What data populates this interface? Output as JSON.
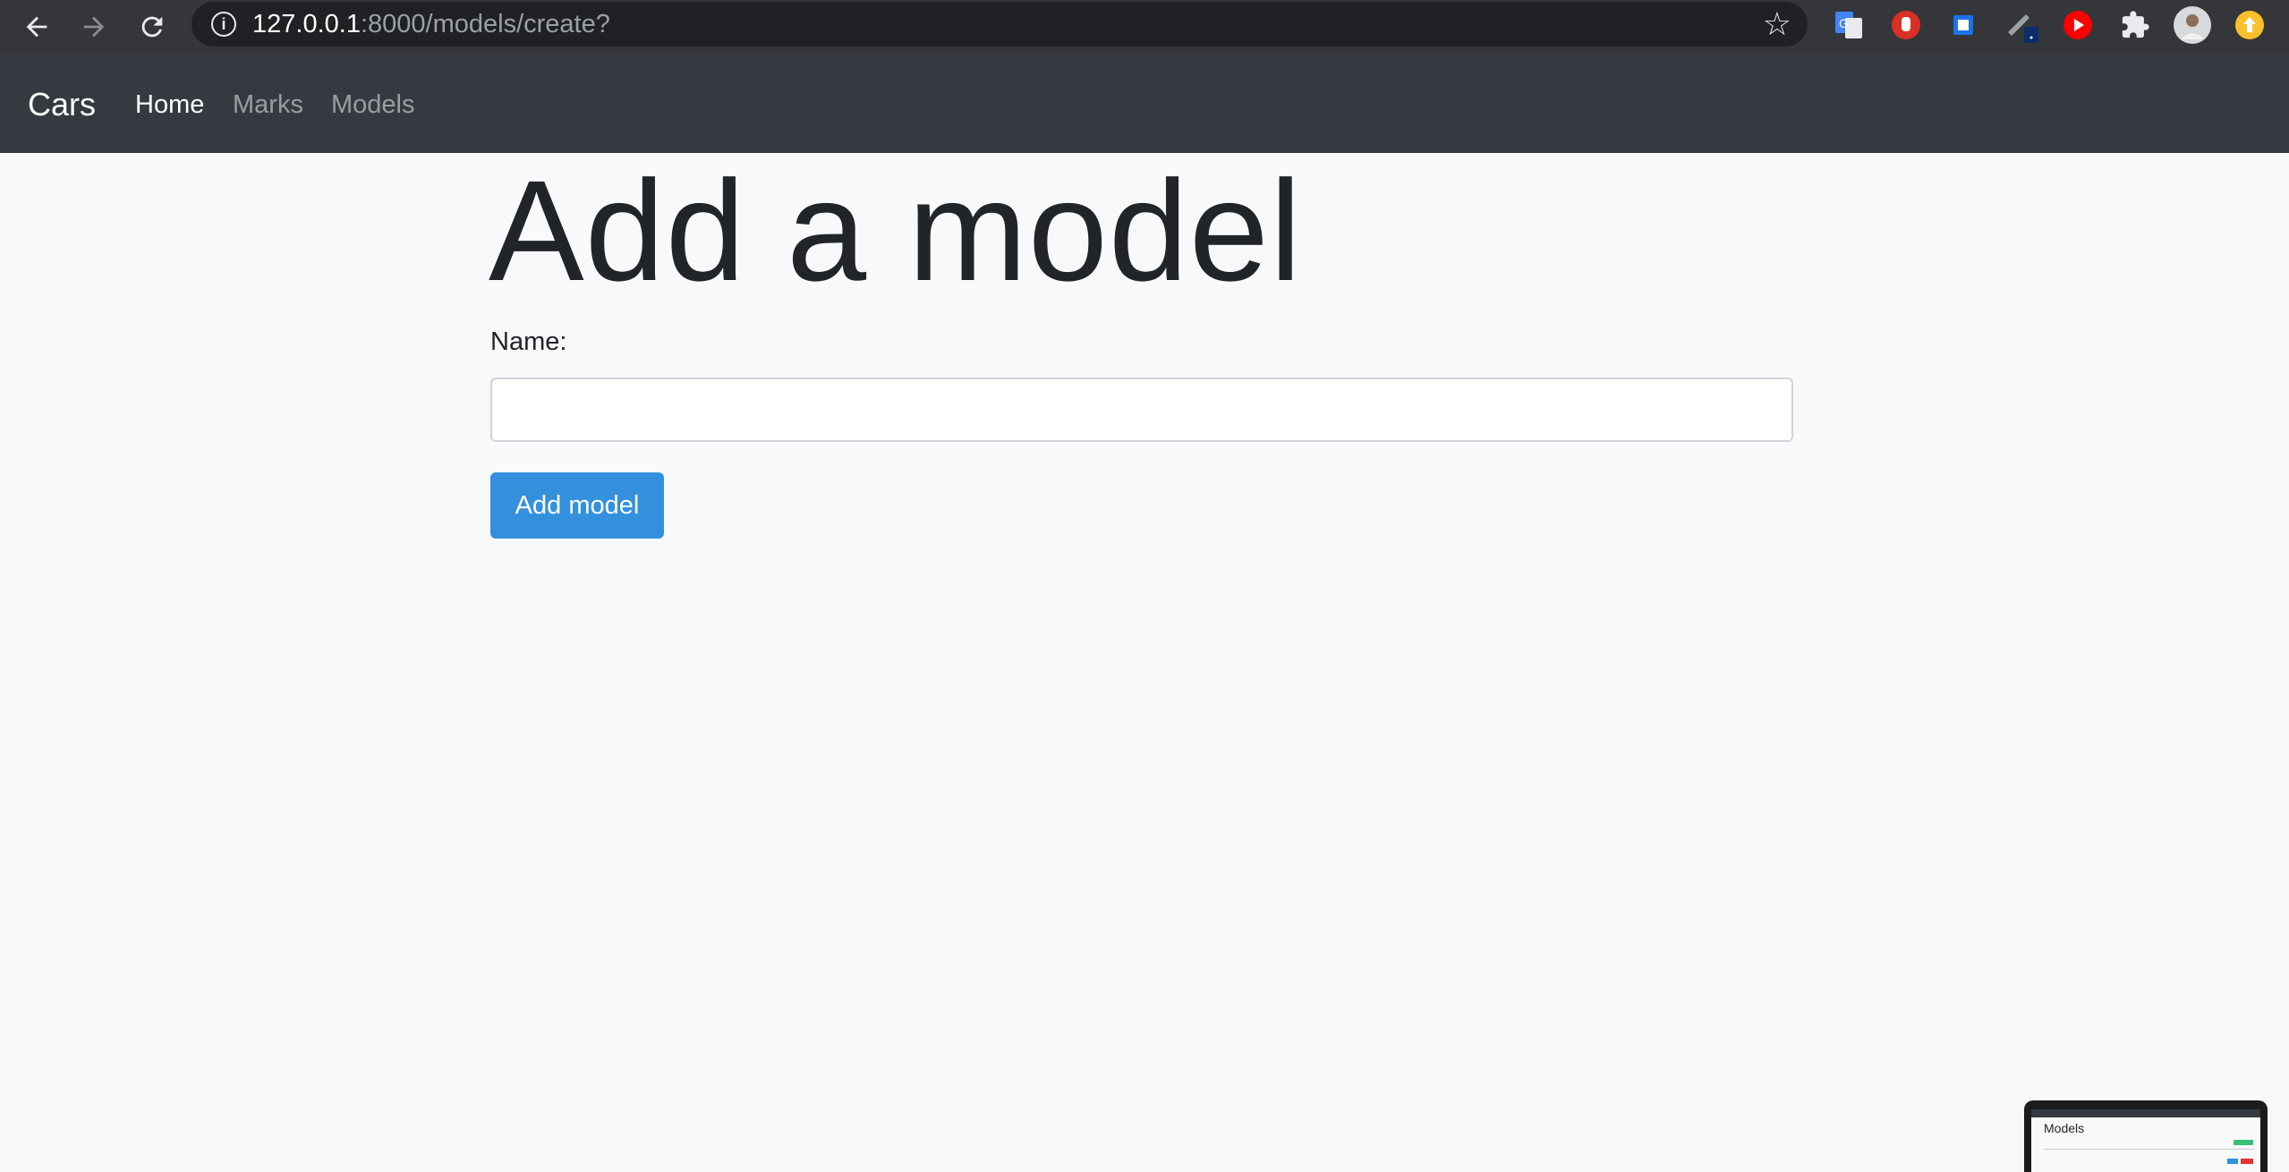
{
  "browser": {
    "url_host": "127.0.0.1",
    "url_rest": ":8000/models/create?"
  },
  "navbar": {
    "brand": "Cars",
    "links": [
      {
        "label": "Home",
        "active": true
      },
      {
        "label": "Marks",
        "active": false
      },
      {
        "label": "Models",
        "active": false
      }
    ]
  },
  "main": {
    "title": "Add a model",
    "name_label": "Name:",
    "name_value": "",
    "name_placeholder": "",
    "submit_label": "Add model"
  },
  "thumbnail": {
    "title": "Models"
  },
  "colors": {
    "navbar_bg": "#343a40",
    "primary": "#3490dc",
    "page_bg": "#f8f9fa"
  },
  "icons": {
    "back": "arrow-left-icon",
    "forward": "arrow-right-icon",
    "reload": "reload-icon",
    "info": "info-icon",
    "bookmark": "star-icon",
    "extensions": [
      "google-translate-icon",
      "hand-stop-icon",
      "square-icon",
      "eyedropper-icon",
      "youtube-icon",
      "puzzle-icon",
      "profile-avatar",
      "update-icon"
    ]
  }
}
